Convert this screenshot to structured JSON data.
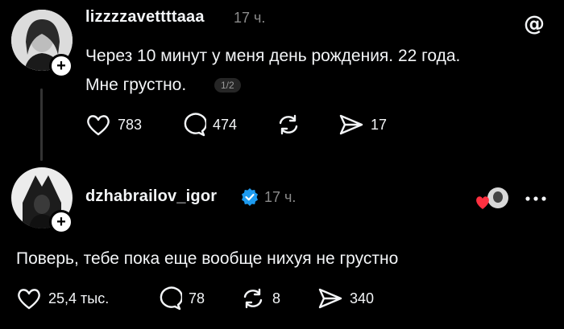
{
  "post1": {
    "username": "lizzzzavettttaaa",
    "time": "17 ч.",
    "line1": "Через 10 минут у меня день рождения. 22 года.",
    "line2": "Мне грустно.",
    "page_badge": "1/2",
    "likes": "783",
    "comments": "474",
    "shares": "17"
  },
  "post2": {
    "username": "dzhabrailov_igor",
    "time": "17 ч.",
    "text": "Поверь, тебе пока еще вообще нихуя не грустно",
    "likes": "25,4 тыс.",
    "comments": "78",
    "reposts": "8",
    "shares": "340"
  },
  "icons": [
    "threads-logo-icon",
    "plus-icon",
    "heart-icon",
    "comment-icon",
    "repost-icon",
    "share-icon",
    "verified-icon",
    "more-icon",
    "liked-by-author-icon"
  ],
  "colors": {
    "background": "#000000",
    "text": "#f3f5f7",
    "muted": "#8b8b8b",
    "verified": "#1d9bf0",
    "heart": "#ff3040"
  }
}
